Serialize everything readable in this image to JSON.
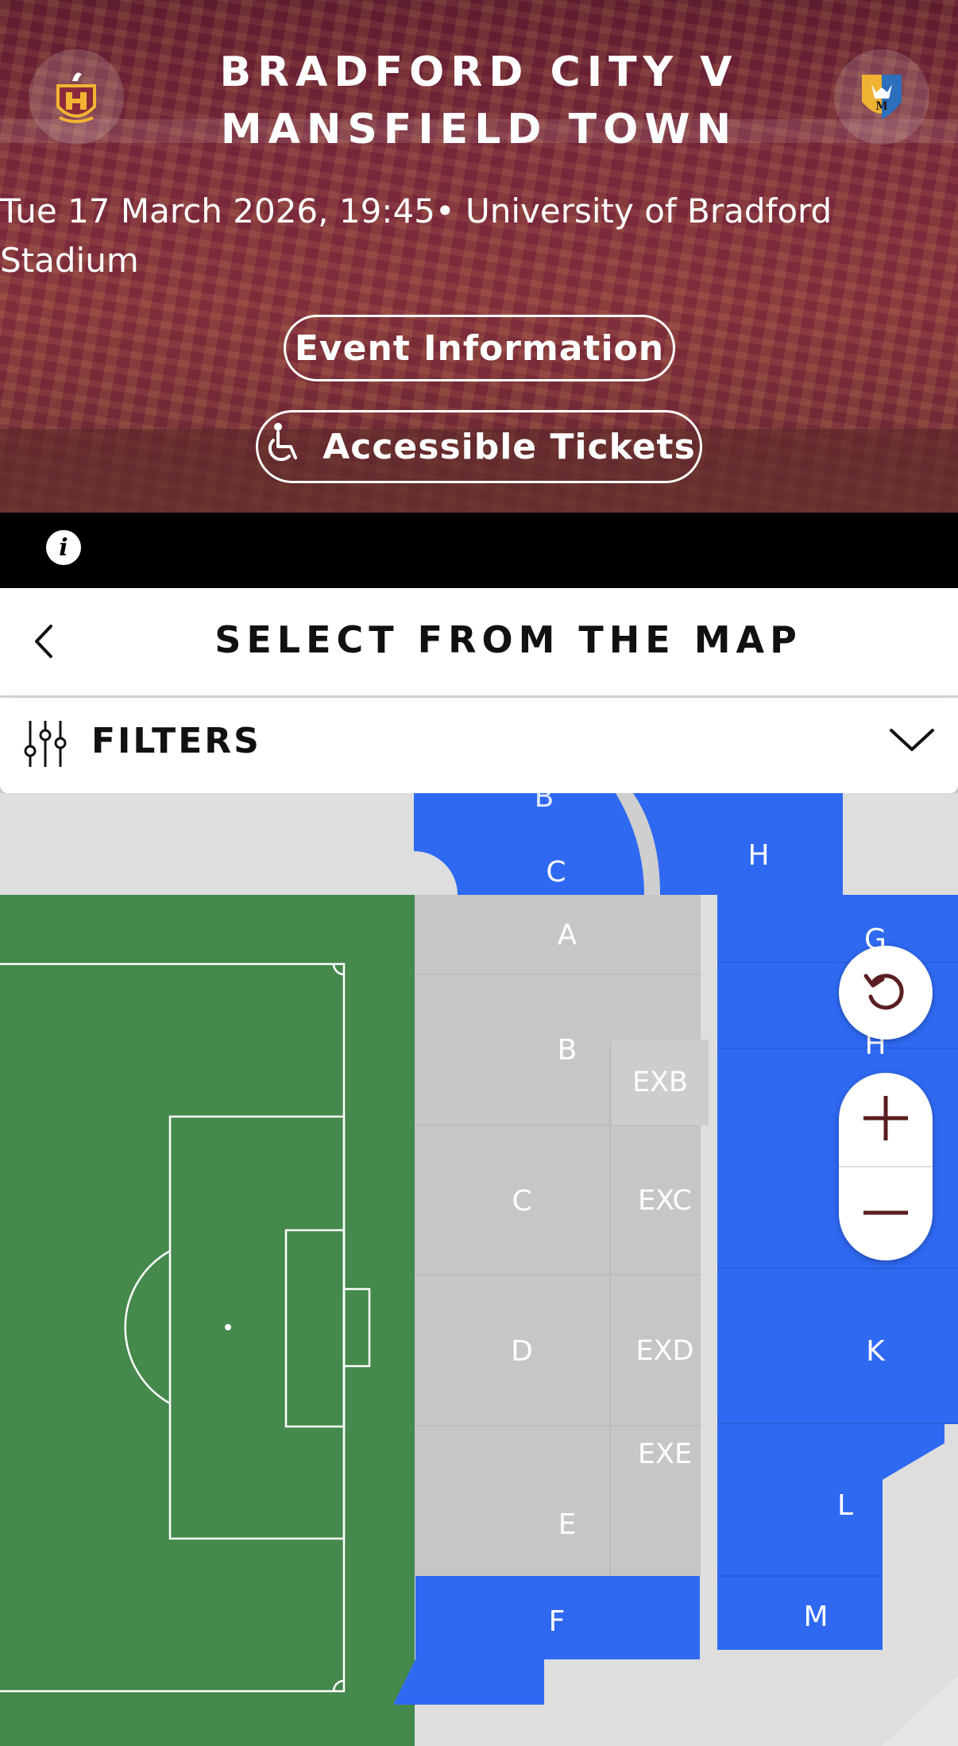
{
  "event": {
    "title_line1": "BRADFORD CITY V",
    "title_line2": "MANSFIELD TOWN",
    "subtitle": "Tue 17 March 2026, 19:45• University of Bradford Stadium",
    "event_info_label": "Event Information",
    "accessible_tickets_label": "Accessible Tickets"
  },
  "info_icon_glyph": "i",
  "page": {
    "title": "SELECT FROM THE MAP",
    "filters_label": "FILTERS"
  },
  "map": {
    "sections": {
      "top_b": "B",
      "top_c": "C",
      "top_h": "H",
      "g": "G",
      "h": "H",
      "a": "A",
      "b": "B",
      "exb": "EXB",
      "c": "C",
      "exc": "EXC",
      "d": "D",
      "exd": "EXD",
      "e": "E",
      "exe": "EXE",
      "f": "F",
      "k": "K",
      "l": "L",
      "m": "M"
    }
  },
  "colors": {
    "available": "#2f69f2",
    "unavailable": "#c6c6c6",
    "pitch": "#45894d",
    "hero": "#6e2637",
    "control_icon": "#5a1e22"
  },
  "icons": [
    "home-club-crest-icon",
    "away-club-crest-icon",
    "wheelchair-icon",
    "info-icon",
    "chevron-left-icon",
    "sliders-icon",
    "chevron-down-icon",
    "reset-icon",
    "zoom-in-icon",
    "zoom-out-icon"
  ]
}
